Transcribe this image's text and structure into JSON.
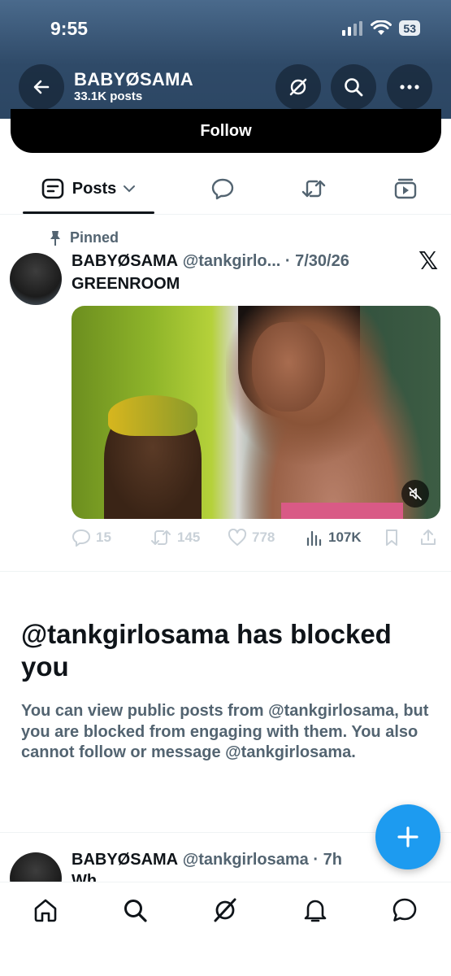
{
  "status_bar": {
    "time": "9:55",
    "battery": "53"
  },
  "profile": {
    "name": "BABYØSAMA",
    "post_count": "33.1K posts"
  },
  "follow_button": {
    "label": "Follow"
  },
  "tabs": {
    "posts_label": "Posts"
  },
  "pinned_post": {
    "pinned_label": "Pinned",
    "author_name": "BABYØSAMA",
    "author_handle": "@tankgirlo...",
    "date": "· 7/30/26",
    "text": "GREENROOM",
    "stats": {
      "replies": "15",
      "reposts": "145",
      "likes": "778",
      "views": "107K"
    }
  },
  "blocked_notice": {
    "title": "@tankgirlosama has blocked you",
    "body": "You can view public posts from @tankgirlosama, but you are blocked from engaging with them. You also cannot follow or message @tankgirlosama."
  },
  "second_post": {
    "author_name": "BABYØSAMA",
    "author_handle": "@tankgirlosama",
    "time": "· 7h",
    "text": "Wh..."
  },
  "colors": {
    "accent": "#1d9bf0",
    "header_bg": "#2f4a68",
    "text_primary": "#0f1419",
    "text_secondary": "#536471"
  }
}
